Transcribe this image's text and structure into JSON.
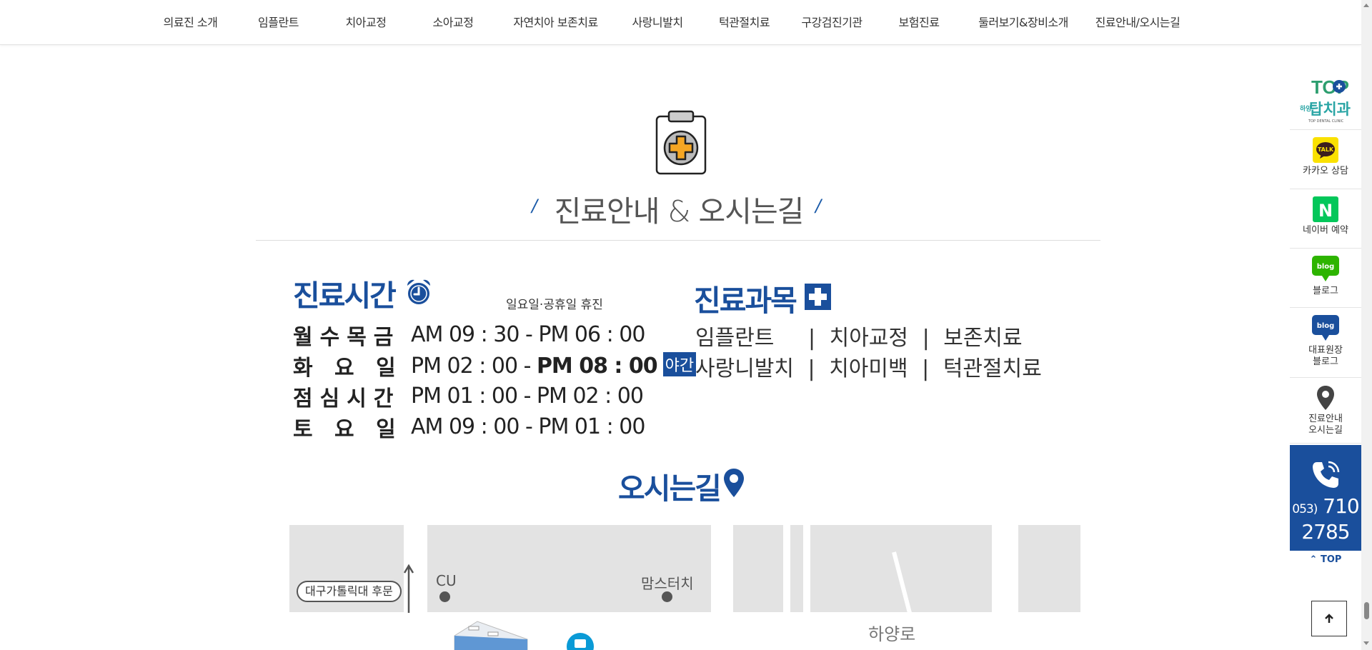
{
  "nav": {
    "items": [
      {
        "label": "의료진 소개"
      },
      {
        "label": "임플란트"
      },
      {
        "label": "치아교정"
      },
      {
        "label": "소아교정"
      },
      {
        "label": "자연치아 보존치료"
      },
      {
        "label": "사랑니발치"
      },
      {
        "label": "턱관절치료"
      },
      {
        "label": "구강검진기관"
      },
      {
        "label": "보험진료"
      },
      {
        "label": "둘러보기&장비소개"
      },
      {
        "label": "진료안내/오시는길"
      }
    ]
  },
  "section": {
    "title": "진료안내 & 오시는길",
    "slash_left": "/",
    "slash_right": "/"
  },
  "hours": {
    "title": "진료시간",
    "closed_note": "일요일·공휴일 휴진",
    "rows": [
      {
        "day": "월수목금",
        "time": "AM 09 : 30 - PM 06 : 00"
      },
      {
        "day": "화 요 일",
        "time_start": "PM 02 : 00 - ",
        "time_end": "PM 08 : 00",
        "badge": "야간"
      },
      {
        "day": "점심시간",
        "time": "PM 01 : 00 - PM 02 : 00"
      },
      {
        "day": "토 요 일",
        "time": "AM 09 : 00 - PM 01 : 00"
      }
    ]
  },
  "departments": {
    "title": "진료과목",
    "line1": [
      "임플란트",
      "치아교정",
      "보존치료"
    ],
    "line2": [
      "사랑니발치",
      "치아미백",
      "턱관절치료"
    ],
    "separator": "|"
  },
  "directions": {
    "title": "오시는길",
    "map": {
      "bubble": "대구가톨릭대 후문",
      "cu": "CU",
      "momstouch": "맘스터치",
      "road": "하양로"
    }
  },
  "quickbar": {
    "logo_top": "TOP",
    "logo_main": "탑치과",
    "logo_sub": "TOP DENTAL CLINIC",
    "logo_side": "하양",
    "kakao_icon_text": "TALK",
    "kakao": "카카오 상담",
    "naver_icon_text": "N",
    "naver": "네이버 예약",
    "blog_icon_text": "blog",
    "blog": "블로그",
    "blog2_line1": "대표원장",
    "blog2_line2": "블로그",
    "map_line1": "진료안내",
    "map_line2": "오시는길",
    "phone_area": "053)",
    "phone_a": "710",
    "phone_b": "2785",
    "top": "TOP"
  },
  "colors": {
    "brand_blue": "#1a4f9c",
    "kakao_yellow": "#fae100",
    "naver_green": "#03c75a"
  }
}
